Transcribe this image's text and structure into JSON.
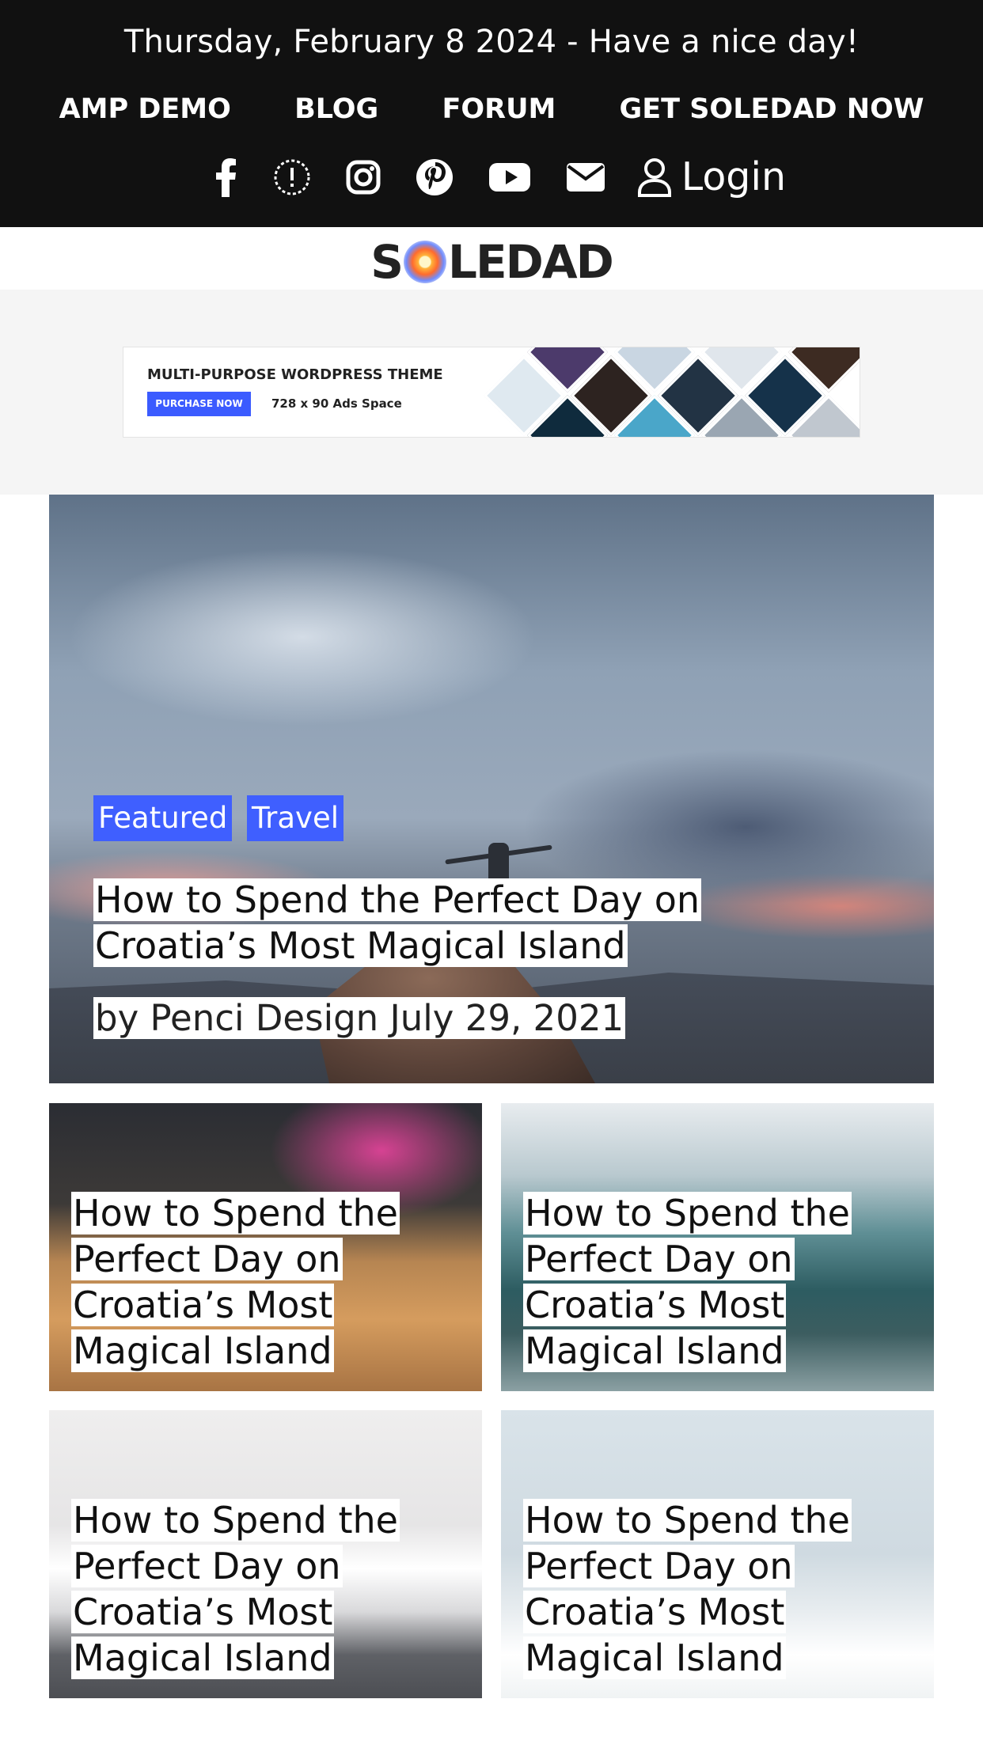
{
  "topbar": {
    "date_line": "Thursday, February 8 2024 - Have a nice day!",
    "nav": [
      "AMP DEMO",
      "BLOG",
      "FORUM",
      "GET SOLEDAD NOW"
    ],
    "social_icons": [
      "facebook-icon",
      "threads-icon",
      "instagram-icon",
      "pinterest-icon",
      "youtube-icon",
      "email-icon"
    ],
    "login_label": "Login"
  },
  "logo": {
    "s": "S",
    "rest": "LEDAD"
  },
  "ad": {
    "title": "MULTI-PURPOSE WORDPRESS THEME",
    "button": "PURCHASE NOW",
    "space": "728 x 90 Ads Space"
  },
  "featured": {
    "tags": [
      "Featured",
      "Travel"
    ],
    "title": "How to Spend the Perfect Day on Croatia’s Most Magical Island",
    "meta": "by Penci Design July 29, 2021"
  },
  "cards": [
    {
      "title": "How to Spend the Perfect Day on Croatia’s Most Magical Island"
    },
    {
      "title": "How to Spend the Perfect Day on Croatia’s Most Magical Island"
    },
    {
      "title": "How to Spend the Perfect Day on Croatia’s Most Magical Island"
    },
    {
      "title": "How to Spend the Perfect Day on Croatia’s Most Magical Island"
    }
  ],
  "colors": {
    "topbar_bg": "#111111",
    "accent": "#3f5fff",
    "ad_band_bg": "#f5f5f5"
  }
}
